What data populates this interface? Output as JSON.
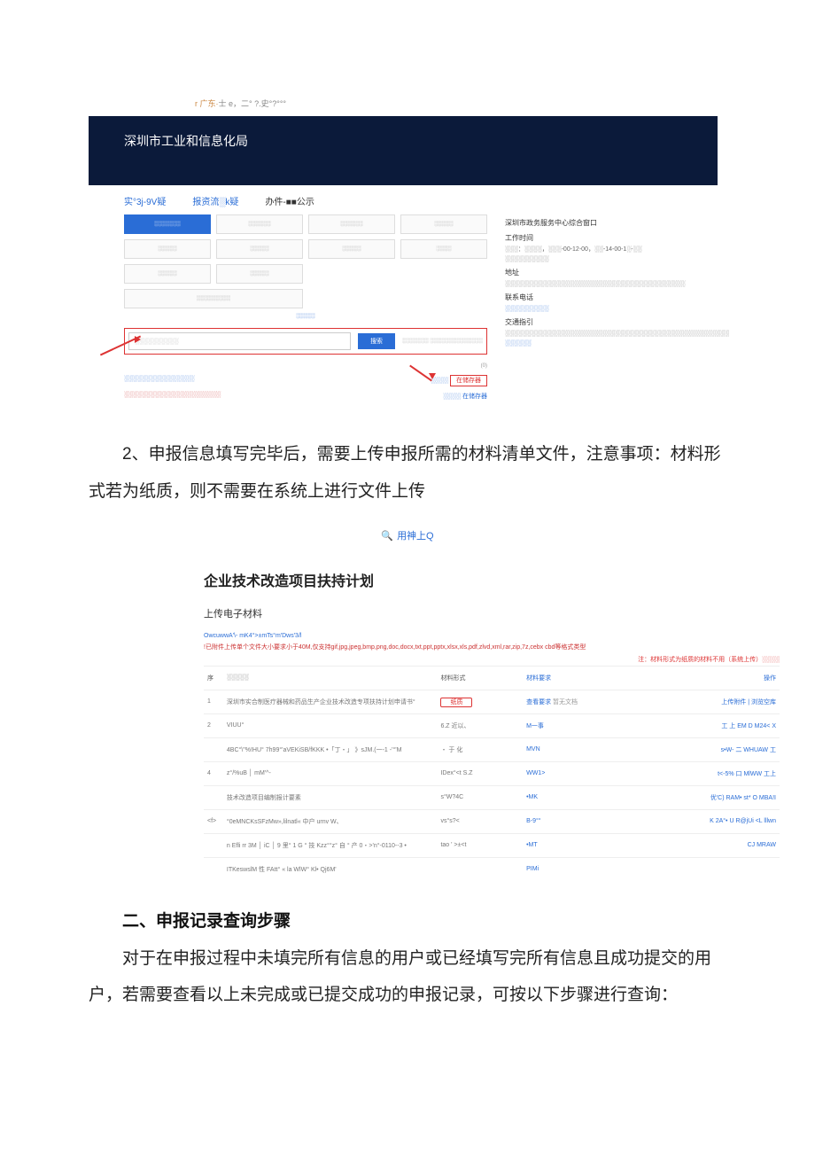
{
  "top_crumb": {
    "prefix": "r 广东·",
    "rest": "士 e，二° ?.史°?°°°"
  },
  "shot1": {
    "banner_title": "深圳市工业和信息化局",
    "tabs": {
      "t1": "实°3j-9V疑",
      "t2": "报资流░k疑",
      "t3": "办件-■■公示"
    },
    "grid": {
      "g1": "░░░░░░░",
      "g2": "░░░░░░",
      "g3": "░░░░░░",
      "g4": "░░░░░",
      "g5": "░░░░░",
      "g6": "░░░░░",
      "g7": "░░░░░",
      "g8": "░░░░",
      "g9": "░░░░░",
      "g10": "░░░░░",
      "g11": "░░░░░░░░░"
    },
    "mid_link": "░░░░░",
    "search_placeholder": "░░░░░░░░░░",
    "search_btn": "搜索",
    "checkbox_text": "░░░░░░░  ░░░░░░░░░░░░░░",
    "foot_left1": "░░░░░░░░░░░░░░░░",
    "foot_right1": "░░░░",
    "foot_right1b": "在储存器",
    "foot_left2": "░░░░░░░░░░░░░░░░░░░░░░",
    "foot_right2": "░░░░  在储存器",
    "right": {
      "title": "深圳市政务服务中心综合窗口",
      "h1": "工作时间",
      "l1": "░░░：░░░░，░░░-00-12-00，░░-14-00-1░-░░ ░░░░░░░░░░",
      "h2": "地址",
      "l2": "░░░░░░░░░░░░░░░░░░░░░░░░░░░░░░░░░░░░░░░░░",
      "h3": "联系电话",
      "l3": "░░░░░░░░░░",
      "h4": "交通指引",
      "l4": "░░░░░░░░░░░░░░░░░░░░░░░░░░░░░░░░░░░░░░░░░░░░░░░░░░░",
      "h5": "░░░░░░"
    }
  },
  "para1": "2、申报信息填写完毕后，需要上传申报所需的材料清单文件，注意事项：材料形式若为纸质，则不需要在系统上进行文件上传",
  "search_icon_text": "用神上Q",
  "shot2": {
    "title": "企业技术改造项目扶持计划",
    "subtitle": "上传电子材料",
    "meta1": "OwcuwwA'\\- mK4°>±mTs°m′Dws′3/l",
    "meta2": "!已附件上传单个文件大小要求小于40M,仅支持gif,jpg,jpeg,bmp,png,doc,docx,txt,ppt,pptx,xlsx,xls,pdf,zlvd,xml,rar,zip,7z,cebx cbd等格式类型",
    "note_red": "注：材料形式为纸质的材料不用（系统上传）░░░░",
    "headers": {
      "idx": "序",
      "name": "░░░░░",
      "form": "材料形式",
      "req": "材料要求",
      "op": "操作"
    },
    "rows": [
      {
        "idx": "1",
        "name": "深圳市实合制医疗器械和药品生产企业技术改造专项扶持计划申请书°",
        "form": "纸质",
        "req1": "查看要求",
        "req2": "暂无文档",
        "op": "上传附件 | 浏览空库"
      },
      {
        "idx": "2",
        "name": "VIUU°",
        "form": "6.Z 近以、",
        "req1": "M一事",
        "req2": "",
        "op": "工 上 EM  D  M24<  X"
      },
      {
        "idx": "",
        "name": "4BC°\\\"%!HU° 7h99°'aVEKiSB/fKKK •「丁・」 》sJM.(一-1 -'°'M",
        "form": "・ 于 化",
        "req1": "MVN",
        "req2": "",
        "op": "s•W- 二   WHUAW  工"
      },
      {
        "idx": "4",
        "name": "z°/%uB │ mM'^-",
        "form": "IDex°<t  S.Z",
        "req1": "WW1>",
        "req2": "",
        "op": "t<-5% 口 MlWW 工上"
      },
      {
        "idx": "",
        "name": "技术改造项目编制报计要素",
        "form": "s°W?4C",
        "req1": "•MK",
        "req2": "",
        "op": "优'C) RAM• st* O MBA!I"
      },
      {
        "idx": "<f>",
        "name": "°0eMNCKsSFzMw»,lilnatl« 中户 urnv W、",
        "form": "vs°s?<",
        "req1": "B-9°°",
        "req2": "",
        "op": "K 2A°• U R@jUi <L lllwn"
      },
      {
        "idx": "",
        "name": "n Efli rr 3M │ iC │ 9 里° 1 G ° 技 Kzz°°z° 自 ° 产 0・>'n°-0110--3 •",
        "form": "tao ' >±<t",
        "req1": "•MT",
        "req2": "",
        "op": "CJ MRAW"
      },
      {
        "idx": "",
        "name": "ITKeswslM 性 FAtt° « la WlW° Kl• Qj6M'",
        "form": "",
        "req1": "PIMi",
        "req2": "",
        "op": ""
      }
    ]
  },
  "section2_title": "二、申报记录查询步骤",
  "para2": "对于在申报过程中未填完所有信息的用户或已经填写完所有信息且成功提交的用户，若需要查看以上未完成或已提交成功的申报记录，可按以下步骤进行查询："
}
